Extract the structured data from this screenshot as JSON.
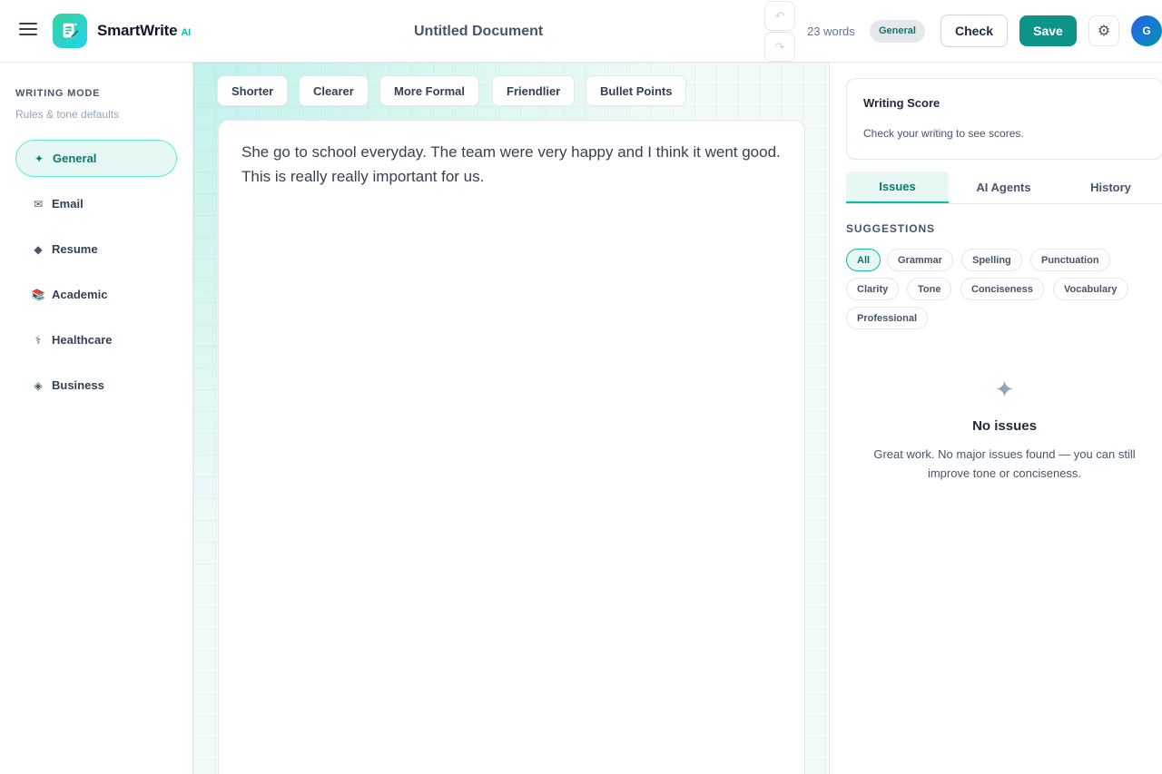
{
  "header": {
    "brand_name": "SmartWrite",
    "brand_suffix": "AI",
    "document_title": "Untitled Document",
    "undo_icon": "↶",
    "redo_icon": "↷",
    "word_count": "23 words",
    "mode_badge": "General",
    "check_label": "Check",
    "save_label": "Save",
    "settings_icon": "⚙",
    "avatar_initial": "G"
  },
  "sidebar": {
    "title": "WRITING MODE",
    "subtitle": "Rules & tone defaults",
    "items": [
      {
        "icon": "✦",
        "label": "General",
        "active": true
      },
      {
        "icon": "✉",
        "label": "Email",
        "active": false
      },
      {
        "icon": "◆",
        "label": "Resume",
        "active": false
      },
      {
        "icon": "📚",
        "label": "Academic",
        "active": false
      },
      {
        "icon": "⚕",
        "label": "Healthcare",
        "active": false
      },
      {
        "icon": "◈",
        "label": "Business",
        "active": false
      }
    ]
  },
  "toolbar": {
    "actions": [
      "Shorter",
      "Clearer",
      "More Formal",
      "Friendlier",
      "Bullet Points"
    ]
  },
  "editor": {
    "text": "She go to school everyday. The team were very happy and I think it went good. This is really really important for us."
  },
  "panel": {
    "score_title": "Writing Score",
    "score_subtitle": "Check your writing to see scores.",
    "tabs": [
      "Issues",
      "AI Agents",
      "History"
    ],
    "active_tab": "Issues",
    "suggestions_title": "SUGGESTIONS",
    "filters": [
      "All",
      "Grammar",
      "Spelling",
      "Punctuation",
      "Clarity",
      "Tone",
      "Conciseness",
      "Vocabulary",
      "Professional"
    ],
    "active_filter": "All",
    "empty_icon": "✦",
    "empty_title": "No issues",
    "empty_description": "Great work. No major issues found — you can still improve tone or conciseness."
  },
  "colors": {
    "accent": "#0d9488",
    "accent_light": "#e6f7f4",
    "accent_border": "#5eead4"
  }
}
